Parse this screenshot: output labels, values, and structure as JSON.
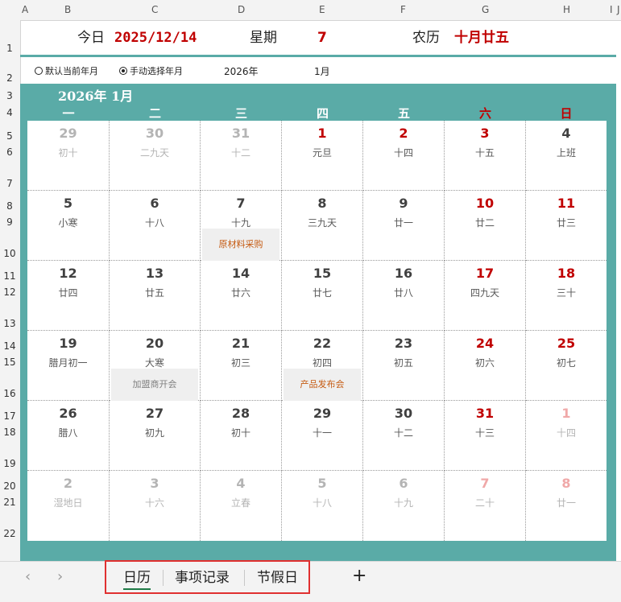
{
  "columns": [
    "A",
    "B",
    "C",
    "D",
    "E",
    "F",
    "G",
    "H",
    "I",
    "J"
  ],
  "rows": [
    "1",
    "2",
    "3",
    "4",
    "5",
    "6",
    "7",
    "8",
    "9",
    "10",
    "11",
    "12",
    "13",
    "14",
    "15",
    "16",
    "17",
    "18",
    "19",
    "20",
    "21",
    "22"
  ],
  "header": {
    "today_label": "今日",
    "today_value": "2025/12/14",
    "weekday_label": "星期",
    "weekday_value": "7",
    "lunar_label": "农历",
    "lunar_value": "十月廿五"
  },
  "controls": {
    "radio_default": "默认当前年月",
    "radio_manual": "手动选择年月",
    "selected": "manual",
    "year": "2026年",
    "month": "1月"
  },
  "calendar": {
    "title": "2026年  1月",
    "weekdays": [
      "一",
      "二",
      "三",
      "四",
      "五",
      "六",
      "日"
    ],
    "weeks": [
      [
        {
          "d": "29",
          "l": "初十",
          "other": true
        },
        {
          "d": "30",
          "l": "二九天",
          "other": true
        },
        {
          "d": "31",
          "l": "十二",
          "other": true
        },
        {
          "d": "1",
          "l": "元旦",
          "red": true
        },
        {
          "d": "2",
          "l": "十四",
          "red": true
        },
        {
          "d": "3",
          "l": "十五",
          "red": true
        },
        {
          "d": "4",
          "l": "上班"
        }
      ],
      [
        {
          "d": "5",
          "l": "小寒"
        },
        {
          "d": "6",
          "l": "十八"
        },
        {
          "d": "7",
          "l": "十九",
          "event": "原材料采购",
          "event_color": "#c55a11"
        },
        {
          "d": "8",
          "l": "三九天"
        },
        {
          "d": "9",
          "l": "廿一"
        },
        {
          "d": "10",
          "l": "廿二",
          "red": true
        },
        {
          "d": "11",
          "l": "廿三",
          "red": true
        }
      ],
      [
        {
          "d": "12",
          "l": "廿四"
        },
        {
          "d": "13",
          "l": "廿五"
        },
        {
          "d": "14",
          "l": "廿六"
        },
        {
          "d": "15",
          "l": "廿七"
        },
        {
          "d": "16",
          "l": "廿八"
        },
        {
          "d": "17",
          "l": "四九天",
          "red": true
        },
        {
          "d": "18",
          "l": "三十",
          "red": true
        }
      ],
      [
        {
          "d": "19",
          "l": "腊月初一"
        },
        {
          "d": "20",
          "l": "大寒",
          "event": "加盟商开会",
          "event_color": "#7f7f7f"
        },
        {
          "d": "21",
          "l": "初三"
        },
        {
          "d": "22",
          "l": "初四",
          "event": "产品发布会",
          "event_color": "#c55a11"
        },
        {
          "d": "23",
          "l": "初五"
        },
        {
          "d": "24",
          "l": "初六",
          "red": true
        },
        {
          "d": "25",
          "l": "初七",
          "red": true
        }
      ],
      [
        {
          "d": "26",
          "l": "腊八"
        },
        {
          "d": "27",
          "l": "初九"
        },
        {
          "d": "28",
          "l": "初十"
        },
        {
          "d": "29",
          "l": "十一"
        },
        {
          "d": "30",
          "l": "十二"
        },
        {
          "d": "31",
          "l": "十三",
          "red": true
        },
        {
          "d": "1",
          "l": "十四",
          "red": true,
          "other": true
        }
      ],
      [
        {
          "d": "2",
          "l": "湿地日",
          "other": true
        },
        {
          "d": "3",
          "l": "十六",
          "other": true
        },
        {
          "d": "4",
          "l": "立春",
          "other": true
        },
        {
          "d": "5",
          "l": "十八",
          "other": true
        },
        {
          "d": "6",
          "l": "十九",
          "other": true
        },
        {
          "d": "7",
          "l": "二十",
          "red": true,
          "other": true
        },
        {
          "d": "8",
          "l": "廿一",
          "red": true,
          "other": true
        }
      ]
    ]
  },
  "tabs": {
    "items": [
      "日历",
      "事项记录",
      "节假日"
    ],
    "active": 0,
    "add_label": "+",
    "prev_label": "‹",
    "next_label": "›"
  },
  "colors": {
    "accent_teal": "#5aaba7",
    "holiday_red": "#c00000",
    "highlight_box": "#e03030"
  }
}
